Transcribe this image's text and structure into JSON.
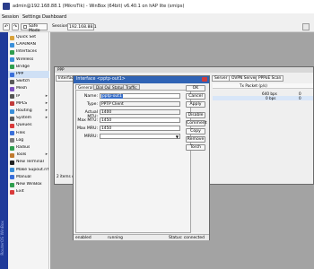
{
  "window": {
    "title": "admin@192.168.88.1 (MikroTik) - WinBox (64bit) v6.40.1 on hAP lite (smips)",
    "menu": [
      "Session",
      "Settings",
      "Dashboard"
    ],
    "safe_mode_label": "Safe Mode",
    "session_label": "Session:",
    "session_value": "192.168.88.1",
    "undo_icon": "undo-icon",
    "redo_icon": "redo-icon"
  },
  "sidebar": {
    "vertical_text": "RouterOS WinBox",
    "items": [
      {
        "label": "Quick Set",
        "icon": "quick-set-icon",
        "color": "#d9a23a",
        "arrow": ""
      },
      {
        "label": "CAPsMAN",
        "icon": "capsman-icon",
        "color": "#3a8fd9",
        "arrow": ""
      },
      {
        "label": "Interfaces",
        "icon": "interfaces-icon",
        "color": "#2f9e4f",
        "arrow": ""
      },
      {
        "label": "Wireless",
        "icon": "wireless-icon",
        "color": "#3a8fd9",
        "arrow": ""
      },
      {
        "label": "Bridge",
        "icon": "bridge-icon",
        "color": "#2f9e4f",
        "arrow": ""
      },
      {
        "label": "PPP",
        "icon": "ppp-icon",
        "color": "#3a6fd9",
        "arrow": ""
      },
      {
        "label": "Switch",
        "icon": "switch-icon",
        "color": "#5a5a5a",
        "arrow": ""
      },
      {
        "label": "Mesh",
        "icon": "mesh-icon",
        "color": "#7a4fc0",
        "arrow": ""
      },
      {
        "label": "IP",
        "icon": "ip-icon",
        "color": "#555555",
        "arrow": "▸"
      },
      {
        "label": "MPLS",
        "icon": "mpls-icon",
        "color": "#c03a3a",
        "arrow": "▸"
      },
      {
        "label": "Routing",
        "icon": "routing-icon",
        "color": "#3a8fd9",
        "arrow": "▸"
      },
      {
        "label": "System",
        "icon": "system-icon",
        "color": "#5a5a5a",
        "arrow": "▸"
      },
      {
        "label": "Queues",
        "icon": "queues-icon",
        "color": "#d93a3a",
        "arrow": ""
      },
      {
        "label": "Files",
        "icon": "files-icon",
        "color": "#3a6fd9",
        "arrow": ""
      },
      {
        "label": "Log",
        "icon": "log-icon",
        "color": "#7a7a7a",
        "arrow": ""
      },
      {
        "label": "Radius",
        "icon": "radius-icon",
        "color": "#2f9e4f",
        "arrow": ""
      },
      {
        "label": "Tools",
        "icon": "tools-icon",
        "color": "#c07a2f",
        "arrow": "▸"
      },
      {
        "label": "New Terminal",
        "icon": "terminal-icon",
        "color": "#222222",
        "arrow": ""
      },
      {
        "label": "Make Supout.rif",
        "icon": "supout-icon",
        "color": "#3a8fd9",
        "arrow": ""
      },
      {
        "label": "Manual",
        "icon": "manual-icon",
        "color": "#3a6fd9",
        "arrow": ""
      },
      {
        "label": "New WinBox",
        "icon": "winbox-icon",
        "color": "#2f9e4f",
        "arrow": ""
      },
      {
        "label": "Exit",
        "icon": "exit-icon",
        "color": "#d93a3a",
        "arrow": ""
      }
    ]
  },
  "ppp": {
    "title": "PPP",
    "tabs": [
      "Interface",
      "Server",
      "OVPN Server",
      "PPPoE Scan"
    ],
    "column_header": "Tx Packet (p/s)",
    "rows": [
      [
        "640 bps",
        "0"
      ],
      [
        "0 bps",
        "0"
      ]
    ],
    "footer": "2 items out of"
  },
  "dialog": {
    "title": "Interface <pptp-out1>",
    "tabs": [
      "General",
      "Dial Out",
      "Status",
      "Traffic"
    ],
    "active_tab": "General",
    "fields": [
      {
        "label": "Name:",
        "value": "pptp-out1",
        "highlight": true
      },
      {
        "label": "Type:",
        "value": "PPTP Client",
        "readonly": true
      },
      {
        "label": "Actual MTU:",
        "value": "1400",
        "readonly": true
      },
      {
        "label": "Max MTU:",
        "value": "1450"
      },
      {
        "label": "Max MRU:",
        "value": "1450"
      },
      {
        "label": "MRRU:",
        "value": "",
        "dropdown": true
      }
    ],
    "buttons": [
      "OK",
      "Cancel",
      "Apply",
      "Disable",
      "Comment",
      "Copy",
      "Remove",
      "Torch"
    ],
    "status": {
      "left": "enabled",
      "middle": "running",
      "right": "Status: connected"
    }
  }
}
